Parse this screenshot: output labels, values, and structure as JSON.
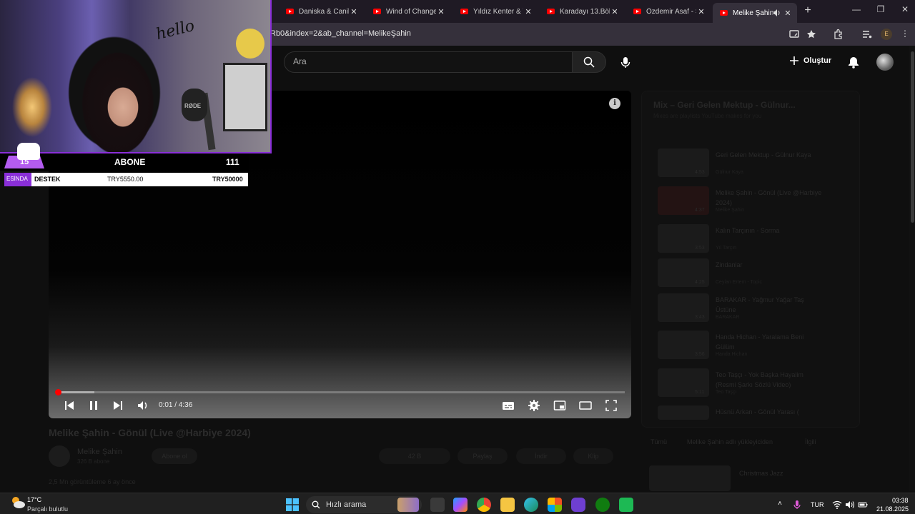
{
  "browser": {
    "tabs": [
      {
        "label": "Daniska & Canik",
        "active": false
      },
      {
        "label": "Wind of Change",
        "active": false
      },
      {
        "label": "Yıldız Kenter & Y",
        "active": false
      },
      {
        "label": "Karadayı 13.Bölü",
        "active": false
      },
      {
        "label": "Özdemir Asaf - S",
        "active": false
      },
      {
        "label": "Melike Şahin",
        "active": true
      }
    ],
    "tab_close": "✕",
    "new_tab": "+",
    "url": "Rb0&index=2&ab_channel=MelikeŞahin",
    "profile_initial": "E"
  },
  "youtube": {
    "search_placeholder": "Ara",
    "create_label": "Oluştur"
  },
  "player": {
    "info": "i",
    "time": "0:01 / 4:36",
    "progress_fraction": 0.004
  },
  "video": {
    "title": "Melike Şahin - Gönül (Live @Harbiye 2024)",
    "channel": "Melike Şahin",
    "subscribers": "326 B abone",
    "subscribe_label": "Abone ol",
    "likes": "42 B",
    "share_label": "Paylaş",
    "download_label": "İndir",
    "clip_label": "Klip",
    "description": "2,5 Mn görüntüleme  6 ay önce"
  },
  "playlist": {
    "title": "Mix – Geri Gelen Mektup - Gülnur...",
    "subtitle": "Mixes are playlists YouTube makes for you",
    "items": [
      {
        "title": "Geri Gelen Mektup - Gülnur Kaya",
        "channel": "Gülnur Kaya",
        "duration": "4:53"
      },
      {
        "title": "Melike Şahin - Gönül (Live @Harbiye 2024)",
        "channel": "Melike Şahin",
        "duration": "4:37"
      },
      {
        "title": "Kalın Tarçının - Sorma",
        "channel": "Yıl Tarçın",
        "duration": "3:53"
      },
      {
        "title": "Zindanlar",
        "channel": "Ceylan Ertem - Topic",
        "duration": "4:25"
      },
      {
        "title": "BARAKAR - Yağmur Yağar Taş Üstüne",
        "channel": "BARAKAR",
        "duration": "3:43"
      },
      {
        "title": "Handa Hichan - Yaralama Beni Gülüm",
        "channel": "Handa Hichan",
        "duration": "3:56"
      },
      {
        "title": "Teo Taşçı - Yok Başka Hayalim (Resmi Şarkı Sözlü Video)",
        "channel": "Teo Taşçı",
        "duration": "5:11"
      },
      {
        "title": "Hüsnü Arkan - Gönül Yarası (",
        "channel": "",
        "duration": ""
      }
    ],
    "chips": [
      "Tümü",
      "Melike Şahin adlı yükleyiciden",
      "İlgili"
    ],
    "recommended_title": "Christmas Jazz"
  },
  "stream": {
    "abone_count_badge": "15",
    "abone_label": "ABONE",
    "abone_value": "111",
    "destek_tag": "ESİNDA",
    "destek_label": "DESTEK",
    "destek_current": "TRY5550.00",
    "destek_goal": "TRY50000",
    "hello_sign": "hello",
    "mic_brand": "RØDE"
  },
  "taskbar": {
    "weather_temp": "17°C",
    "weather_desc": "Parçalı bulutlu",
    "search_label": "Hızlı arama",
    "language": "TUR",
    "time": "03:38",
    "date": "21.08.2025"
  },
  "colors": {
    "accent_purple": "#8a2fd8",
    "youtube_red": "#ff0000"
  }
}
